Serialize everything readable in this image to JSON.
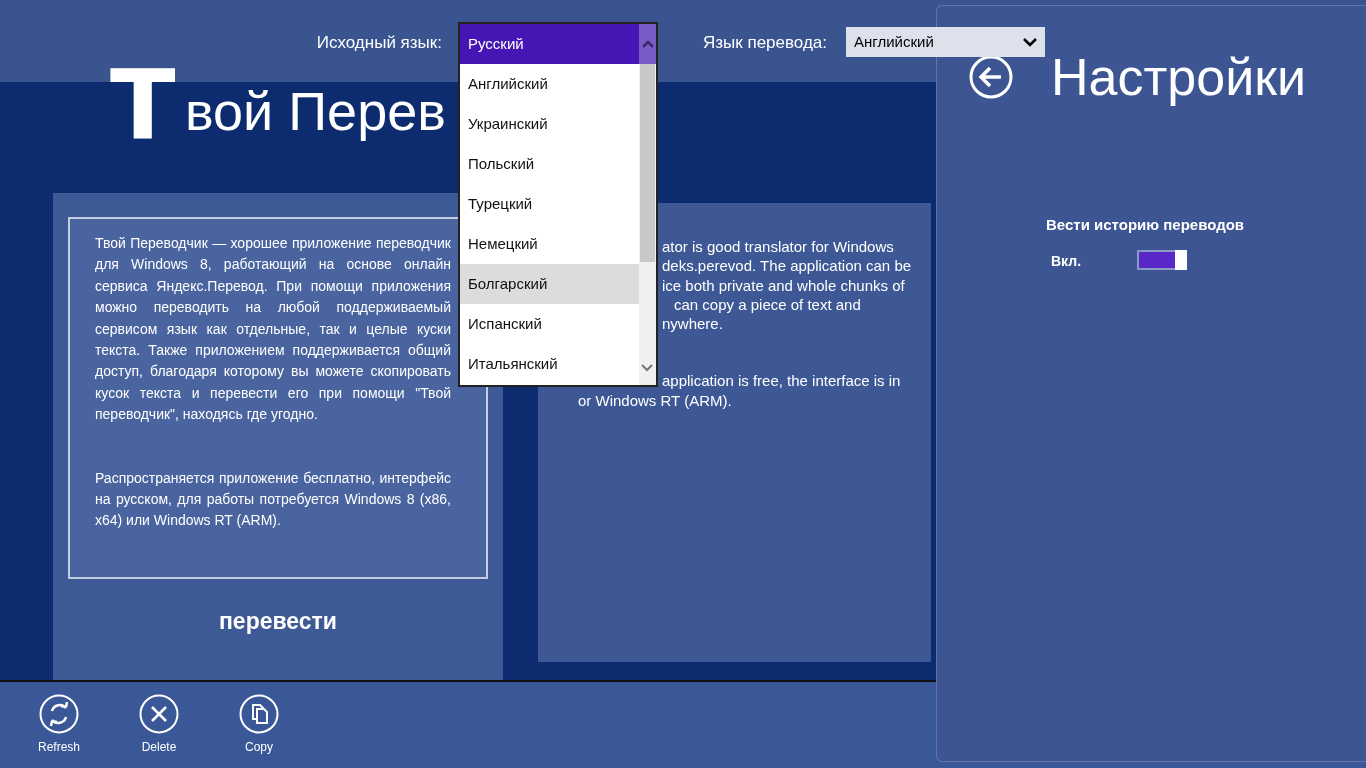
{
  "top_bar": {
    "source_label": "Исходный язык:",
    "target_label": "Язык перевода:",
    "target_value": "Английский"
  },
  "source_dropdown": {
    "items": [
      {
        "label": "Русский",
        "selected": true,
        "highlighted": false
      },
      {
        "label": "Английский",
        "selected": false,
        "highlighted": false
      },
      {
        "label": "Украинский",
        "selected": false,
        "highlighted": false
      },
      {
        "label": "Польский",
        "selected": false,
        "highlighted": false
      },
      {
        "label": "Турецкий",
        "selected": false,
        "highlighted": false
      },
      {
        "label": "Немецкий",
        "selected": false,
        "highlighted": false
      },
      {
        "label": "Болгарский",
        "selected": false,
        "highlighted": true
      },
      {
        "label": "Испанский",
        "selected": false,
        "highlighted": false
      },
      {
        "label": "Итальянский",
        "selected": false,
        "highlighted": false
      }
    ]
  },
  "app_title": {
    "initial": "Т",
    "rest": "вой Перев"
  },
  "source_panel": {
    "paragraphs": [
      "Твой Переводчик —  хорошее приложение переводчик для Windows 8, работающий на основе онлайн сервиса Яндекс.Перевод. При помощи приложения можно переводить на любой поддерживаемый сервисом язык как отдельные, так и целые куски текста. Также приложением поддерживается общий доступ, благодаря которому вы можете скопировать кусок текста и перевести его при помощи \"Твой переводчик\", находясь где угодно.",
      "Распространяется приложение бесплатно, интерфейс на русском, для работы потребуется Windows 8 (x86, x64) или Windows RT (ARM)."
    ],
    "translate_button": "перевести"
  },
  "result_panel": {
    "paragraphs": [
      [
        "ator is good translator for Windows",
        "deks.perevod. The application can be",
        "ice both private and whole chunks of",
        "can copy a piece of text and",
        "nywhere."
      ],
      [
        "application is free, the interface is in",
        "or Windows RT (ARM)."
      ]
    ]
  },
  "settings": {
    "title": "Настройки",
    "section": "Вести историю переводов",
    "toggle": {
      "label": "Вкл.",
      "on": true
    }
  },
  "app_bar": {
    "buttons": [
      {
        "kind": "refresh",
        "label": "Refresh"
      },
      {
        "kind": "delete",
        "label": "Delete"
      },
      {
        "kind": "copy",
        "label": "Copy"
      }
    ]
  }
}
